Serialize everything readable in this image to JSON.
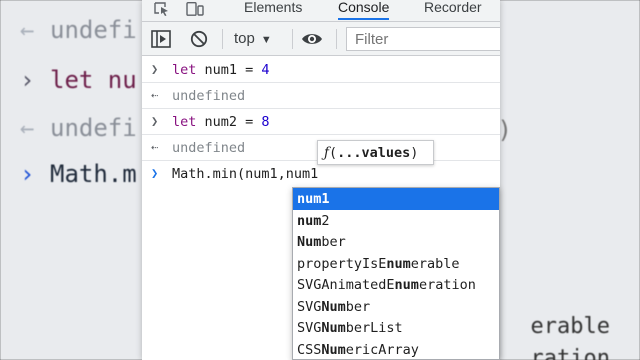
{
  "background": {
    "lines": [
      {
        "arrow": "←",
        "text": "undefi"
      },
      {
        "arrow": "›",
        "text": "let nu"
      },
      {
        "arrow": "←",
        "text": "undefi"
      },
      {
        "arrow": "›",
        "text": "Math.m"
      }
    ],
    "right_hints": [
      "erable",
      "ration"
    ],
    "paren": ")"
  },
  "tabbar": {
    "inspect_icon": "inspect-element-icon",
    "device_icon": "device-toolbar-icon",
    "tabs": [
      {
        "label": "Elements",
        "active": false
      },
      {
        "label": "Console",
        "active": true
      },
      {
        "label": "Recorder",
        "active": false
      }
    ]
  },
  "toolbar": {
    "sidebar_icon": "sidebar-toggle-icon",
    "clear_icon": "clear-console-icon",
    "context": "top",
    "eye_icon": "live-expression-eye-icon",
    "filter_placeholder": "Filter"
  },
  "console": {
    "entries": [
      {
        "type": "input",
        "keyword": "let",
        "rest": " num1 = ",
        "value": "4"
      },
      {
        "type": "output",
        "text": "undefined"
      },
      {
        "type": "input",
        "keyword": "let",
        "rest": " num2 = ",
        "value": "8"
      },
      {
        "type": "output",
        "text": "undefined"
      }
    ],
    "prompt_text": "Math.min(num1,num1"
  },
  "hint": {
    "fn": "ƒ",
    "open": "(",
    "params": "...values",
    "close": ")"
  },
  "autocomplete": {
    "items": [
      {
        "pre": "",
        "match": "num1",
        "post": "",
        "selected": true
      },
      {
        "pre": "",
        "match": "num",
        "post": "2",
        "selected": false
      },
      {
        "pre": "",
        "match": "Num",
        "post": "ber",
        "selected": false
      },
      {
        "pre": "propertyIsE",
        "match": "num",
        "post": "erable",
        "selected": false
      },
      {
        "pre": "SVGAnimatedE",
        "match": "num",
        "post": "eration",
        "selected": false
      },
      {
        "pre": "SVG",
        "match": "Num",
        "post": "ber",
        "selected": false
      },
      {
        "pre": "SVG",
        "match": "Num",
        "post": "berList",
        "selected": false
      },
      {
        "pre": "CSS",
        "match": "Num",
        "post": "ericArray",
        "selected": false
      }
    ]
  },
  "colors": {
    "accent": "#1a73e8",
    "keyword": "#881280",
    "number": "#1c00cf",
    "undefined": "#80868b"
  }
}
